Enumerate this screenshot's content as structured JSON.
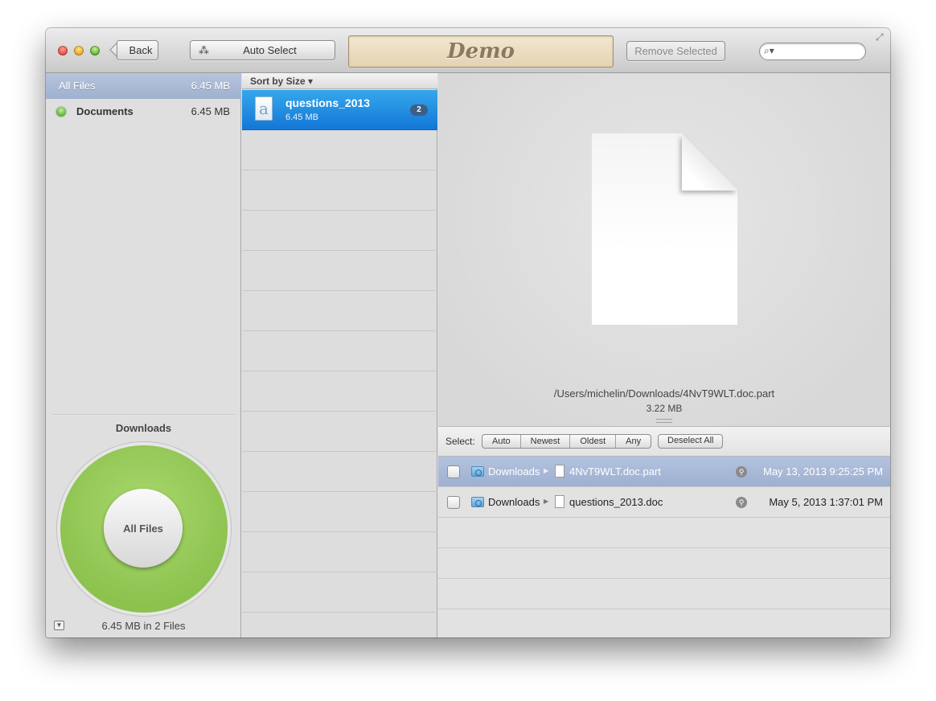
{
  "toolbar": {
    "back_label": "Back",
    "auto_select_label": "Auto Select",
    "demo_label": "Demo",
    "remove_selected_label": "Remove Selected",
    "search_placeholder": ""
  },
  "sidebar": {
    "items": [
      {
        "label": "All Files",
        "size": "6.45 MB"
      },
      {
        "label": "Documents",
        "size": "6.45 MB",
        "color": "#6cc13f"
      }
    ],
    "section_label": "Downloads",
    "chart_center_label": "All Files",
    "footer": "6.45 MB in 2 Files",
    "chart_color": "#98ca5c"
  },
  "list": {
    "sort_label": "Sort by Size ▾",
    "items": [
      {
        "name": "questions_2013",
        "size": "6.45 MB",
        "count": "2"
      }
    ]
  },
  "preview": {
    "path": "/Users/michelin/Downloads/4NvT9WLT.doc.part",
    "size": "3.22 MB"
  },
  "select_bar": {
    "label": "Select:",
    "options": [
      "Auto",
      "Newest",
      "Oldest",
      "Any"
    ],
    "deselect_label": "Deselect All"
  },
  "files": [
    {
      "folder": "Downloads",
      "name": "4NvT9WLT.doc.part",
      "date": "May 13, 2013 9:25:25 PM"
    },
    {
      "folder": "Downloads",
      "name": "questions_2013.doc",
      "date": "May 5, 2013 1:37:01 PM"
    }
  ],
  "colors": {
    "selection_blue": "#1f8ae0",
    "sidebar_selection": "#a9b9d6"
  }
}
